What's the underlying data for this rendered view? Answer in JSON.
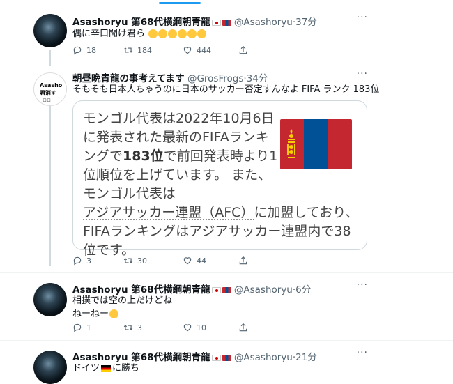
{
  "tweets": [
    {
      "name": "Asashoryu 第68代横綱朝青龍",
      "handle": "@Asashoryu",
      "time": "37分",
      "text": "偶に辛口聞け君ら",
      "replies": "18",
      "retweets": "184",
      "likes": "444"
    },
    {
      "name": "朝昼晩青龍の事考えてます",
      "handle": "@GrosFrogs",
      "time": "34分",
      "text": "そもそも日本人ちゃうのに日本のサッカー否定すんなよ FIFA ランク 183位",
      "avatar_text": "Asasho\n君消す",
      "avatar_sub": "ロロ",
      "card": {
        "line1": "モンゴル代表は2022年10月6日",
        "line2": "に発表された最新のFIFAランキ",
        "line3a": "ングで",
        "line3b": "183位",
        "line3c": "で前回発表時より1",
        "line4": "位順位を上げています。 また、",
        "line5": "モンゴル代表は",
        "line6a": "アジアサッカー連盟（AFC）",
        "line6b": "に加盟しており、",
        "line7": "FIFAランキングはアジアサッカー連盟内で38",
        "line8": "位です。"
      },
      "replies": "3",
      "retweets": "30",
      "likes": "44"
    },
    {
      "name": "Asashoryu 第68代横綱朝青龍",
      "handle": "@Asashoryu",
      "time": "6分",
      "line1": "相撲では空の上だけどね",
      "line2": "ねーねー",
      "replies": "1",
      "retweets": "3",
      "likes": "10"
    },
    {
      "name": "Asashoryu 第68代横綱朝青龍",
      "handle": "@Asashoryu",
      "time": "21分",
      "text_a": "ドイツ",
      "text_b": "に勝ち"
    }
  ],
  "icons": [
    "reply-icon",
    "retweet-icon",
    "like-icon",
    "share-icon",
    "more-icon"
  ],
  "colors": {
    "accent": "#1d9bf0",
    "secondary_text": "#536471",
    "mongolia_red": "#c4272f",
    "mongolia_blue": "#015197"
  }
}
